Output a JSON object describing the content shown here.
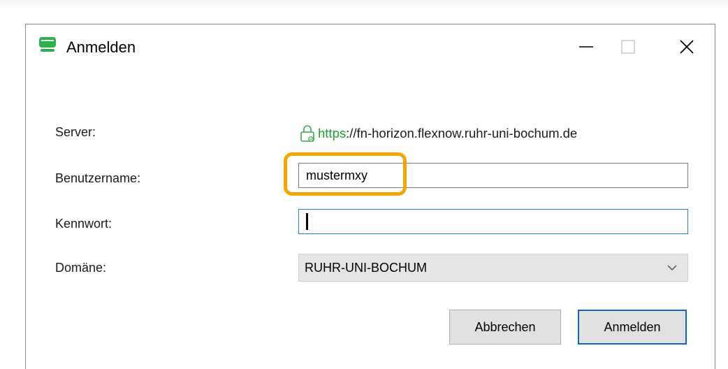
{
  "window": {
    "title": "Anmelden",
    "icon": "monitor-icon"
  },
  "controls": {
    "minimize": "minimize-icon",
    "maximize": "maximize-icon",
    "close": "close-icon"
  },
  "form": {
    "server_label": "Server:",
    "server_scheme": "https",
    "server_rest": "://fn-horizon.flexnow.ruhr-uni-bochum.de",
    "username_label": "Benutzername:",
    "username_value": "mustermxy",
    "password_label": "Kennwort:",
    "password_value": "",
    "domain_label": "Domäne:",
    "domain_value": "RUHR-UNI-BOCHUM"
  },
  "buttons": {
    "cancel": "Abbrechen",
    "login": "Anmelden"
  },
  "colors": {
    "highlight": "#f5a500",
    "https": "#1f9f2b",
    "focus": "#2a7bd6",
    "app_icon": "#2bb24c"
  }
}
